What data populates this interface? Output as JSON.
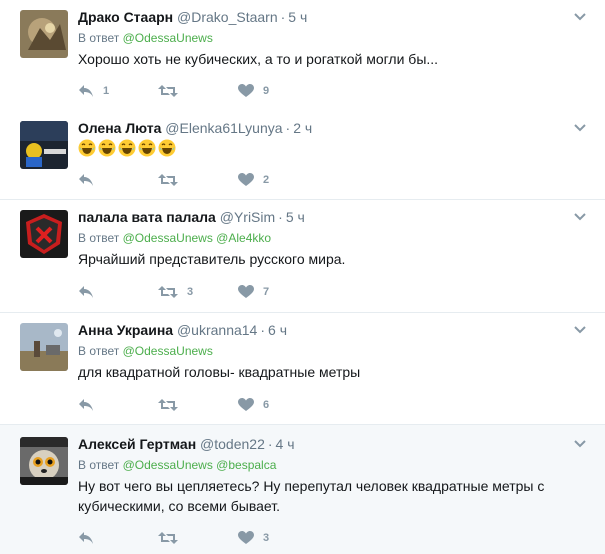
{
  "colors": {
    "link": "#4cae4c",
    "muted": "#657786",
    "icon": "#8899a6"
  },
  "tweets": [
    {
      "fullname": "Драко Стаарн",
      "username": "@Drako_Staarn",
      "time": "5 ч",
      "reply_label": "В ответ",
      "mentions": [
        "@OdessaUnews"
      ],
      "text": "Хорошо хоть не кубических, а то и рогаткой могли бы...",
      "reply_count": "1",
      "retweet_count": "",
      "like_count": "9"
    },
    {
      "fullname": "Олена Люта",
      "username": "@Elenka61Lyunya",
      "time": "2 ч",
      "emoji_count": 5,
      "reply_count": "",
      "retweet_count": "",
      "like_count": "2"
    },
    {
      "fullname": "палала вата палала",
      "username": "@YriSim",
      "time": "5 ч",
      "reply_label": "В ответ",
      "mentions": [
        "@OdessaUnews",
        "@Ale4kko"
      ],
      "text": "Ярчайший представитель русского мира.",
      "reply_count": "",
      "retweet_count": "3",
      "like_count": "7"
    },
    {
      "fullname": "Анна Украина",
      "username": "@ukranna14",
      "time": "6 ч",
      "reply_label": "В ответ",
      "mentions": [
        "@OdessaUnews"
      ],
      "text": "для квадратной головы- квадратные метры",
      "reply_count": "",
      "retweet_count": "",
      "like_count": "6"
    },
    {
      "fullname": "Алексей Гертман",
      "username": "@toden22",
      "time": "4 ч",
      "reply_label": "В ответ",
      "mentions": [
        "@OdessaUnews",
        "@bespalca"
      ],
      "text": "Ну вот чего вы цепляетесь? Ну перепутал человек квадратные метры с кубическими, со всеми бывает.",
      "reply_count": "",
      "retweet_count": "",
      "like_count": "3"
    }
  ]
}
